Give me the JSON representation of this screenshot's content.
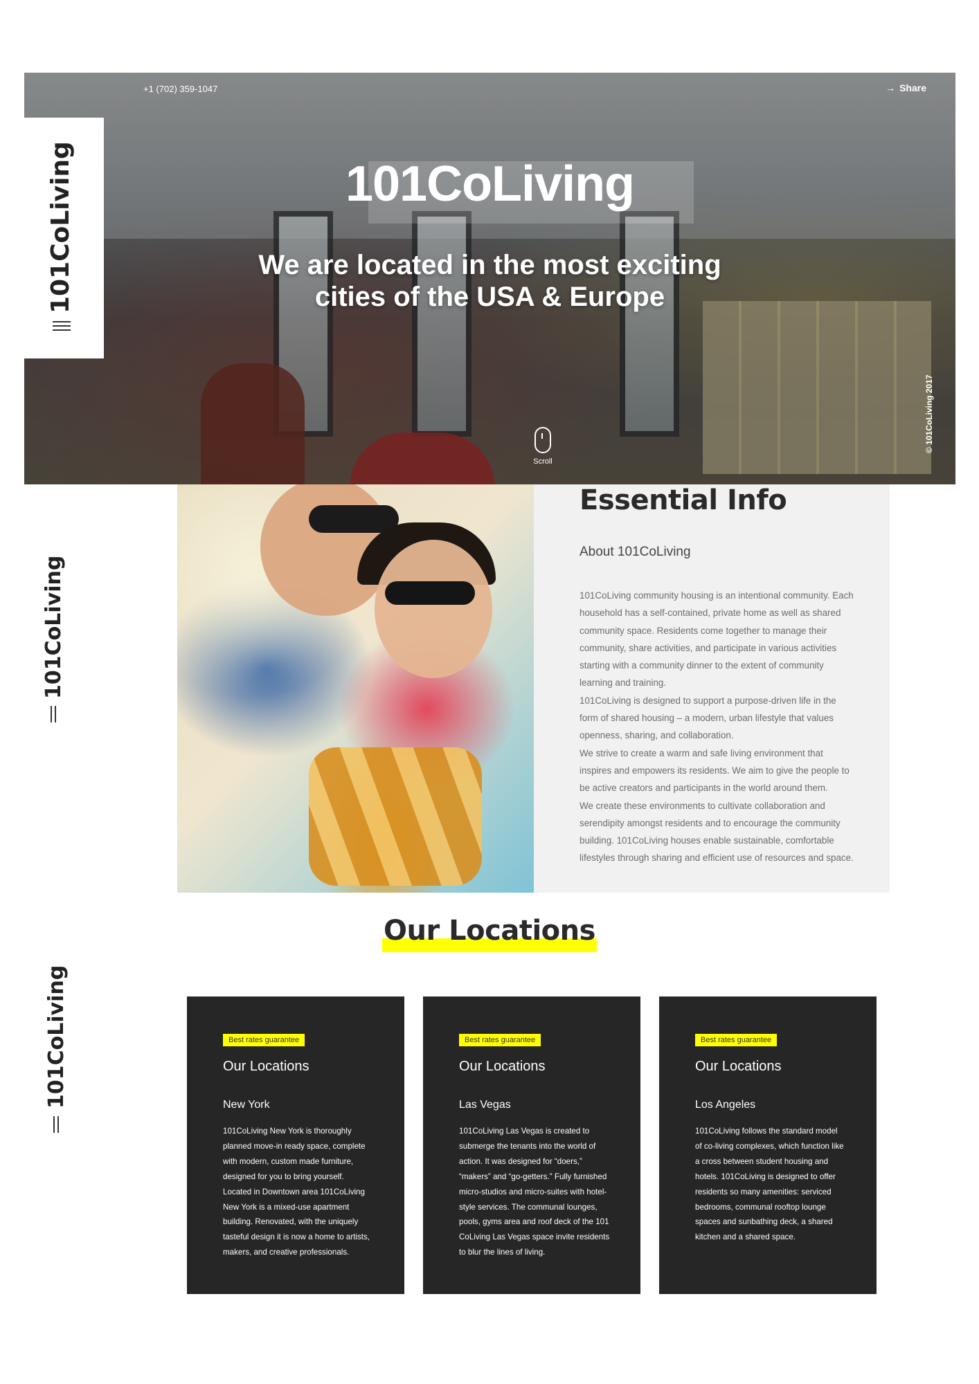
{
  "brand": "101CoLiving",
  "hero": {
    "phone": "+1 (702) 359-1047",
    "share_label": "Share",
    "title": "101CoLiving",
    "subtitle_line1": "We are located in the most exciting",
    "subtitle_line2": "cities of the USA & Europe",
    "scroll_label": "Scroll",
    "copyright": "© 101CoLiving 2017"
  },
  "essential": {
    "title": "Essential Info",
    "subtitle": "About 101CoLiving",
    "paragraphs": [
      "101CoLiving community housing is an intentional community. Each household has a self-contained, private home as well as shared community space. Residents come together to manage their community, share activities, and participate in various activities starting with a community dinner to the extent of community learning and training.",
      "101CoLiving is designed to support a purpose-driven life in the form of shared housing – a modern, urban lifestyle that values openness, sharing, and collaboration.",
      "We strive to create a warm and safe living environment that inspires and empowers its residents. We aim to give the people to be active creators and participants in the world around them.",
      "We create these environments to cultivate collaboration and serendipity amongst residents and to encourage the community building. 101CoLiving houses enable sustainable, comfortable lifestyles through sharing and efficient use of resources and space."
    ]
  },
  "locations": {
    "title": "Our Locations",
    "cards": [
      {
        "badge": "Best rates guarantee",
        "title": "Our Locations",
        "city": "New York",
        "description": "101CoLiving New York is thoroughly planned move-in ready space, complete with modern, custom made furniture, designed for you to bring yourself. Located in Downtown area 101CoLiving New York is a mixed-use apartment building. Renovated, with the uniquely tasteful design it is now a home to artists, makers, and creative professionals."
      },
      {
        "badge": "Best rates guarantee",
        "title": "Our Locations",
        "city": "Las Vegas",
        "description": "101CoLiving Las Vegas is created to submerge the tenants into the world of action. It was designed for “doers,” “makers” and “go-getters.” Fully furnished micro-studios and micro-suites with hotel-style services. The communal lounges, pools, gyms area and roof deck of the 101 CoLiving Las Vegas space invite residents to blur the lines of living."
      },
      {
        "badge": "Best rates guarantee",
        "title": "Our Locations",
        "city": "Los Angeles",
        "description": "101CoLiving follows the standard model of co-living complexes, which function like a cross between student housing and hotels. 101CoLiving is designed to offer residents so many amenities: serviced bedrooms, communal rooftop lounge spaces and sunbathing deck, a shared kitchen and a shared space."
      }
    ]
  },
  "colors": {
    "accent": "#ffff00",
    "card_bg": "#262626",
    "info_bg": "#f1f1f1",
    "heading": "#2a2a2a"
  }
}
